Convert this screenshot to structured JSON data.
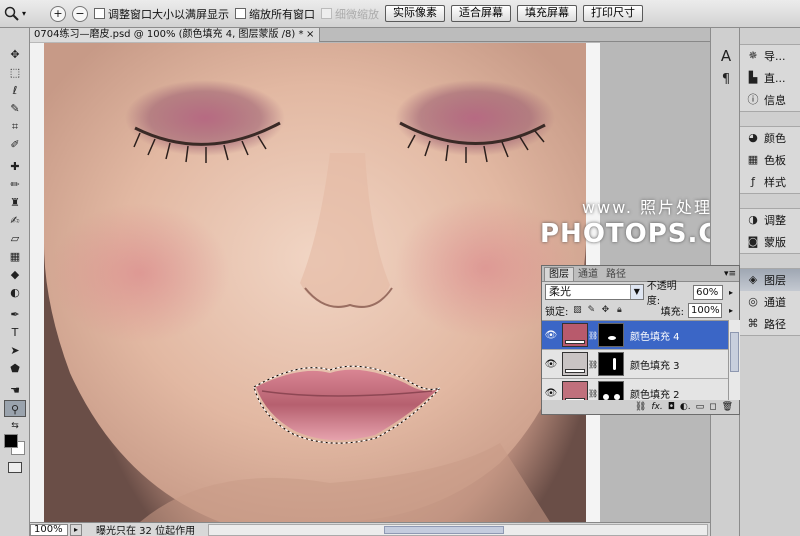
{
  "options_bar": {
    "tool_icon": "zoom-icon",
    "zoom_in": "+",
    "zoom_out": "−",
    "resize_windows_label": "调整窗口大小以满屏显示",
    "zoom_all_windows_label": "缩放所有窗口",
    "scrubby_zoom_label": "细微缩放",
    "actual_pixels_label": "实际像素",
    "fit_screen_label": "适合屏幕",
    "fill_screen_label": "填充屏幕",
    "print_size_label": "打印尺寸"
  },
  "document": {
    "tab_title": "0704练习—磨皮.psd @ 100% (颜色填充 4, 图层蒙版 /8) *",
    "close": "×"
  },
  "watermark": {
    "line1": "www. 照片处理网",
    "line2": "PHOTOPS.COM"
  },
  "status_bar": {
    "zoom": "100%",
    "message": "曝光只在 32 位起作用"
  },
  "dock_b": {
    "group1": [
      {
        "icon": "navigator-icon",
        "label": "导..."
      },
      {
        "icon": "histogram-icon",
        "label": "直..."
      },
      {
        "icon": "info-icon",
        "label": "信息"
      }
    ],
    "group2": [
      {
        "icon": "color-icon",
        "label": "颜色"
      },
      {
        "icon": "swatches-icon",
        "label": "色板"
      },
      {
        "icon": "styles-icon",
        "label": "样式"
      }
    ],
    "group3": [
      {
        "icon": "adjustments-icon",
        "label": "调整"
      },
      {
        "icon": "masks-icon",
        "label": "蒙版"
      }
    ],
    "group4": [
      {
        "icon": "layers-icon",
        "label": "图层"
      },
      {
        "icon": "channels-icon",
        "label": "通道"
      },
      {
        "icon": "paths-icon",
        "label": "路径"
      }
    ]
  },
  "layers_panel": {
    "tabs": [
      "图层",
      "通道",
      "路径"
    ],
    "blend_mode": "柔光",
    "opacity_label": "不透明度:",
    "opacity": "60%",
    "lock_label": "锁定:",
    "fill_label": "填充:",
    "fill": "100%",
    "layers": [
      {
        "name": "颜色填充 4",
        "color": "#b85a6c",
        "active": true
      },
      {
        "name": "颜色填充 3",
        "color": "#c9c4c4",
        "active": false
      },
      {
        "name": "颜色填充 2",
        "color": "#c0707c",
        "active": false
      }
    ]
  },
  "colors": {
    "foreground": "#000000",
    "background": "#ffffff",
    "selection_blue": "#3b66c6"
  }
}
